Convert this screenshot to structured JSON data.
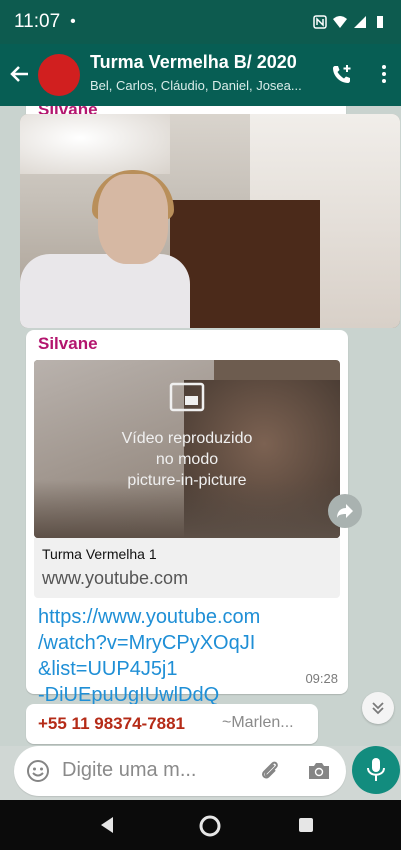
{
  "status_bar": {
    "time": "11:07",
    "dot": "•"
  },
  "header": {
    "title": "Turma Vermelha B/ 2020",
    "subtitle": "Bel, Carlos, Cláudio, Daniel, Josea..."
  },
  "messages": {
    "first_sender": "Silvane",
    "second_sender": "Silvane",
    "preview_overlay": "Vídeo reproduzido\nno modo\npicture-in-picture",
    "card_title": "Turma Vermelha 1",
    "card_domain": "www.youtube.com",
    "link": "https://www.youtube.com\n/watch?v=MryCPyXOqJI\n&list=UUP4J5j1\n-DiUEpuUgIUwlDdQ",
    "time": "09:28",
    "third_phone": "+55 11 98374-7881",
    "third_alias": "~Marlen..."
  },
  "input": {
    "placeholder": "Digite uma m..."
  },
  "colors": {
    "header": "#075e54",
    "sender": "#b3156e",
    "link": "#1f8fd6",
    "mic": "#128c7e"
  }
}
